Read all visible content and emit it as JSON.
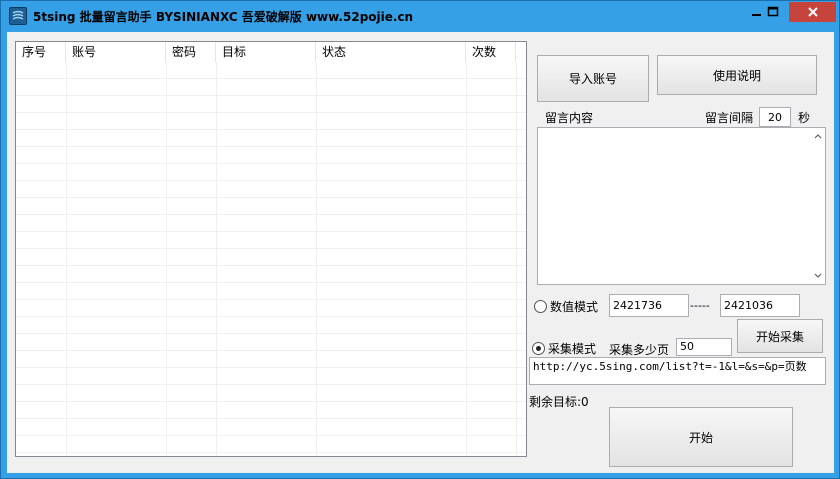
{
  "window": {
    "title": "5tsing 批量留言助手 BYSINIANXC 吾爱破解版 www.52pojie.cn"
  },
  "listview": {
    "columns": [
      "序号",
      "账号",
      "密码",
      "目标",
      "状态",
      "次数"
    ]
  },
  "buttons": {
    "import_accounts": "导入账号",
    "instructions": "使用说明",
    "start_collect": "开始采集",
    "start": "开始"
  },
  "message": {
    "label": "留言内容",
    "interval_label": "留言间隔",
    "interval_value": "20",
    "interval_unit": "秒"
  },
  "numeric_mode": {
    "label": "数值模式",
    "from_value": "2421736",
    "separator": "-----",
    "to_value": "2421036",
    "selected": false
  },
  "collect_mode": {
    "label": "采集模式",
    "pages_label": "采集多少页",
    "pages_value": "50",
    "selected": true
  },
  "url_template": "http://yc.5sing.com/list?t=-1&l=&s=&p=页数",
  "remaining_label": "剩余目标:0"
}
